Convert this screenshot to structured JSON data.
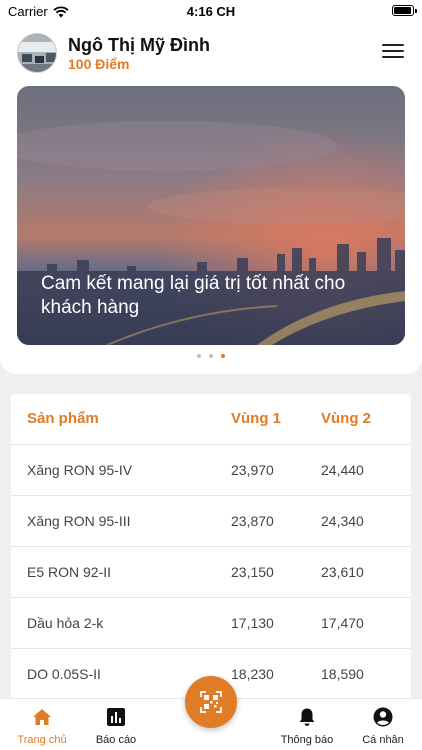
{
  "status_bar": {
    "carrier": "Carrier",
    "time": "4:16 CH"
  },
  "user": {
    "name": "Ngô Thị Mỹ Đình",
    "points": "100 Điểm"
  },
  "banner": {
    "caption": "Cam kết mang lại giá trị tốt nhất cho khách hàng",
    "page_count": 3,
    "active_page": 3
  },
  "price_table": {
    "headers": [
      "Sản phẩm",
      "Vùng 1",
      "Vùng 2"
    ],
    "rows": [
      {
        "product": "Xăng RON 95-IV",
        "zone1": "23,970",
        "zone2": "24,440"
      },
      {
        "product": "Xăng RON 95-III",
        "zone1": "23,870",
        "zone2": "24,340"
      },
      {
        "product": "E5 RON 92-II",
        "zone1": "23,150",
        "zone2": "23,610"
      },
      {
        "product": "Dầu hỏa 2-k",
        "zone1": "17,130",
        "zone2": "17,470"
      },
      {
        "product": "DO 0.05S-II",
        "zone1": "18,230",
        "zone2": "18,590"
      }
    ]
  },
  "tabbar": {
    "tabs": [
      {
        "label": "Trang chủ",
        "icon": "home-icon",
        "active": true
      },
      {
        "label": "Báo cáo",
        "icon": "bar-chart-icon",
        "active": false
      },
      {
        "label": "Thông báo",
        "icon": "bell-icon",
        "active": false
      },
      {
        "label": "Cá nhân",
        "icon": "user-icon",
        "active": false
      }
    ],
    "center_icon": "qr-scan-icon"
  },
  "colors": {
    "accent": "#e07b26",
    "background": "#efeff1"
  }
}
